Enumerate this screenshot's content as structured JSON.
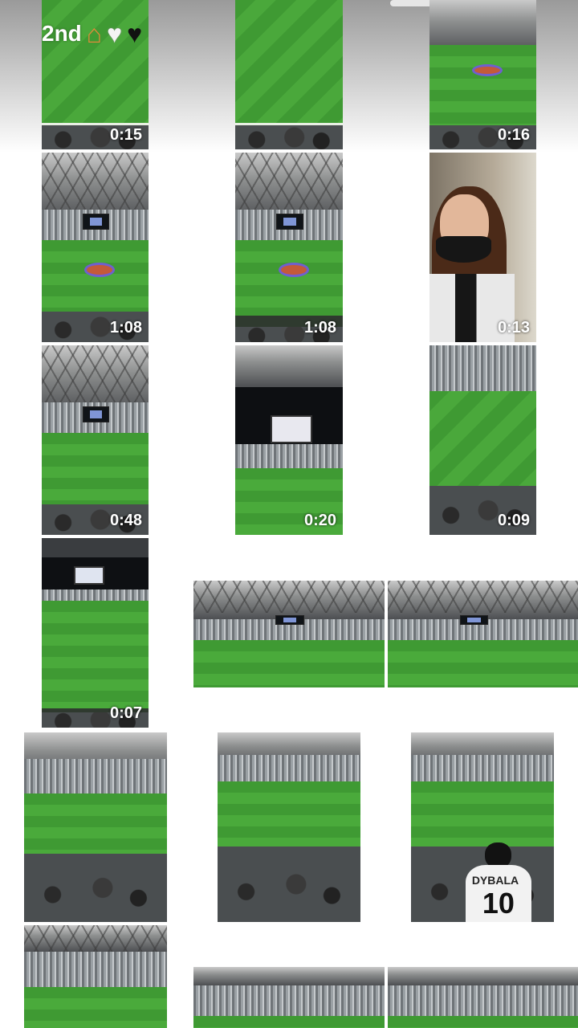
{
  "story": {
    "label": "2nd",
    "icons": [
      "house-icon",
      "white-heart-icon",
      "black-heart-icon"
    ]
  },
  "tiles": [
    {
      "kind": "pitch",
      "duration": "0:15"
    },
    {
      "kind": "pitch",
      "duration": ""
    },
    {
      "kind": "stadium",
      "duration": "0:16"
    },
    {
      "kind": "stadium",
      "duration": "1:08"
    },
    {
      "kind": "stadium",
      "duration": "1:08"
    },
    {
      "kind": "selfie",
      "duration": "0:13"
    },
    {
      "kind": "stadium",
      "duration": "0:48"
    },
    {
      "kind": "stadium",
      "duration": "0:20"
    },
    {
      "kind": "pitch",
      "duration": "0:09"
    },
    {
      "kind": "stadium",
      "duration": "0:07"
    },
    {
      "kind": "stadium",
      "duration": ""
    },
    {
      "kind": "stadium",
      "duration": ""
    },
    {
      "kind": "stadium",
      "duration": ""
    },
    {
      "kind": "stadium",
      "duration": ""
    },
    {
      "kind": "fan",
      "duration": "",
      "jersey_name": "DYBALA",
      "jersey_number": "10"
    },
    {
      "kind": "stadium",
      "duration": ""
    },
    {
      "kind": "stadium",
      "duration": ""
    },
    {
      "kind": "stadium",
      "duration": ""
    }
  ]
}
